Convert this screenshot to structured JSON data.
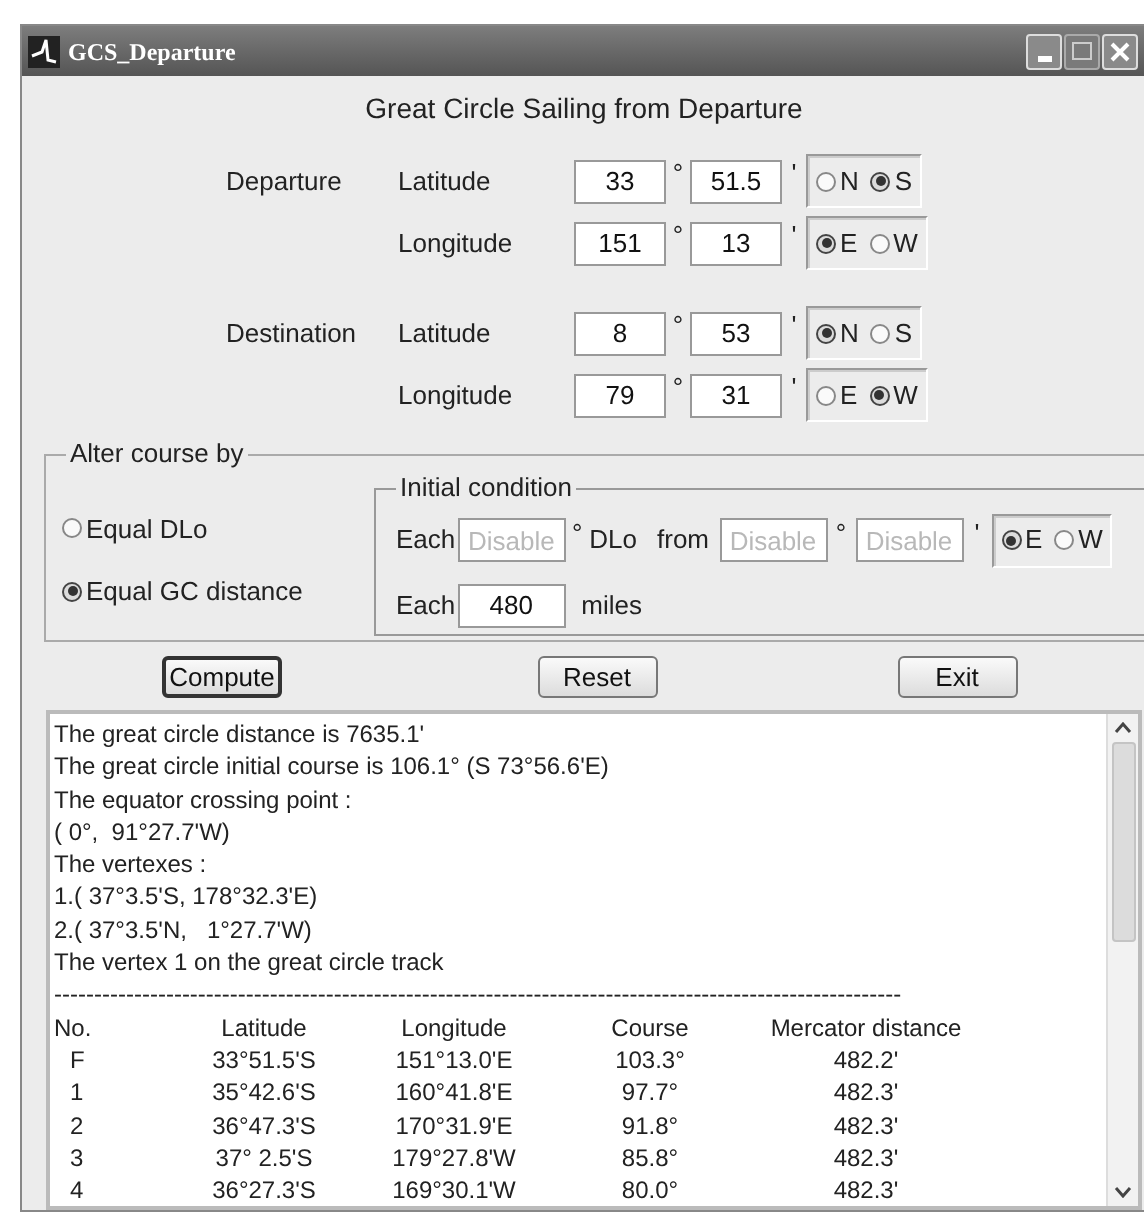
{
  "window": {
    "title": "GCS_Departure"
  },
  "heading": "Great Circle Sailing from Departure",
  "positions": [
    {
      "label": "Departure",
      "coords": [
        {
          "label": "Latitude",
          "degrees": "33",
          "degree_mark": "°",
          "minutes": "51.5",
          "minute_mark": "'",
          "hemispheres": [
            {
              "label": "N",
              "selected": false
            },
            {
              "label": "S",
              "selected": true
            }
          ]
        },
        {
          "label": "Longitude",
          "degrees": "151",
          "degree_mark": "°",
          "minutes": "13",
          "minute_mark": "'",
          "hemispheres": [
            {
              "label": "E",
              "selected": true
            },
            {
              "label": "W",
              "selected": false
            }
          ]
        }
      ]
    },
    {
      "label": "Destination",
      "coords": [
        {
          "label": "Latitude",
          "degrees": "8",
          "degree_mark": "°",
          "minutes": "53",
          "minute_mark": "'",
          "hemispheres": [
            {
              "label": "N",
              "selected": true
            },
            {
              "label": "S",
              "selected": false
            }
          ]
        },
        {
          "label": "Longitude",
          "degrees": "79",
          "degree_mark": "°",
          "minutes": "31",
          "minute_mark": "'",
          "hemispheres": [
            {
              "label": "E",
              "selected": false
            },
            {
              "label": "W",
              "selected": true
            }
          ]
        }
      ]
    }
  ],
  "alter_course": {
    "title": "Alter course by",
    "options": [
      {
        "label": "Equal DLo",
        "selected": false
      },
      {
        "label": "Equal GC distance",
        "selected": true
      }
    ],
    "initial_condition": {
      "title": "Initial condition",
      "dlo_row": {
        "each_label": "Each",
        "each_value": "Disable",
        "each_disabled": true,
        "degree_mark": "°",
        "dlo_label": "DLo",
        "from_label": "from",
        "from_degrees": "Disable",
        "from_degrees_disabled": true,
        "from_degree_mark": "°",
        "from_minutes": "Disable",
        "from_minutes_disabled": true,
        "from_minute_mark": "'",
        "hemispheres": [
          {
            "label": "E",
            "selected": true
          },
          {
            "label": "W",
            "selected": false
          }
        ]
      },
      "distance_row": {
        "each_label": "Each",
        "value": "480",
        "unit": "miles"
      }
    }
  },
  "buttons": [
    {
      "label": "Compute",
      "focused": true
    },
    {
      "label": "Reset",
      "focused": false
    },
    {
      "label": "Exit",
      "focused": false
    }
  ],
  "output": {
    "lines": [
      "The great circle distance is 7635.1'",
      "The great circle initial course is 106.1° (S 73°56.6'E)",
      "The equator crossing point :",
      "( 0°,  91°27.7'W)",
      "The vertexes :",
      "1.( 37°3.5'S, 178°32.3'E)",
      "2.( 37°3.5'N,   1°27.7'W)",
      "The vertex 1 on the great circle track"
    ],
    "separator": "----------------------------------------------------------------------------------------------------------",
    "table": {
      "columns": [
        "No.",
        "Latitude",
        "Longitude",
        "Course",
        "Mercator distance"
      ],
      "rows": [
        [
          "F",
          "33°51.5'S",
          "151°13.0'E",
          "103.3°",
          "482.2'"
        ],
        [
          "1",
          "35°42.6'S",
          "160°41.8'E",
          "97.7°",
          "482.3'"
        ],
        [
          "2",
          "36°47.3'S",
          "170°31.9'E",
          "91.8°",
          "482.3'"
        ],
        [
          "3",
          "37° 2.5'S",
          "179°27.8'W",
          "85.8°",
          "482.3'"
        ],
        [
          "4",
          "36°27.3'S",
          "169°30.1'W",
          "80.0°",
          "482.3'"
        ]
      ]
    }
  }
}
